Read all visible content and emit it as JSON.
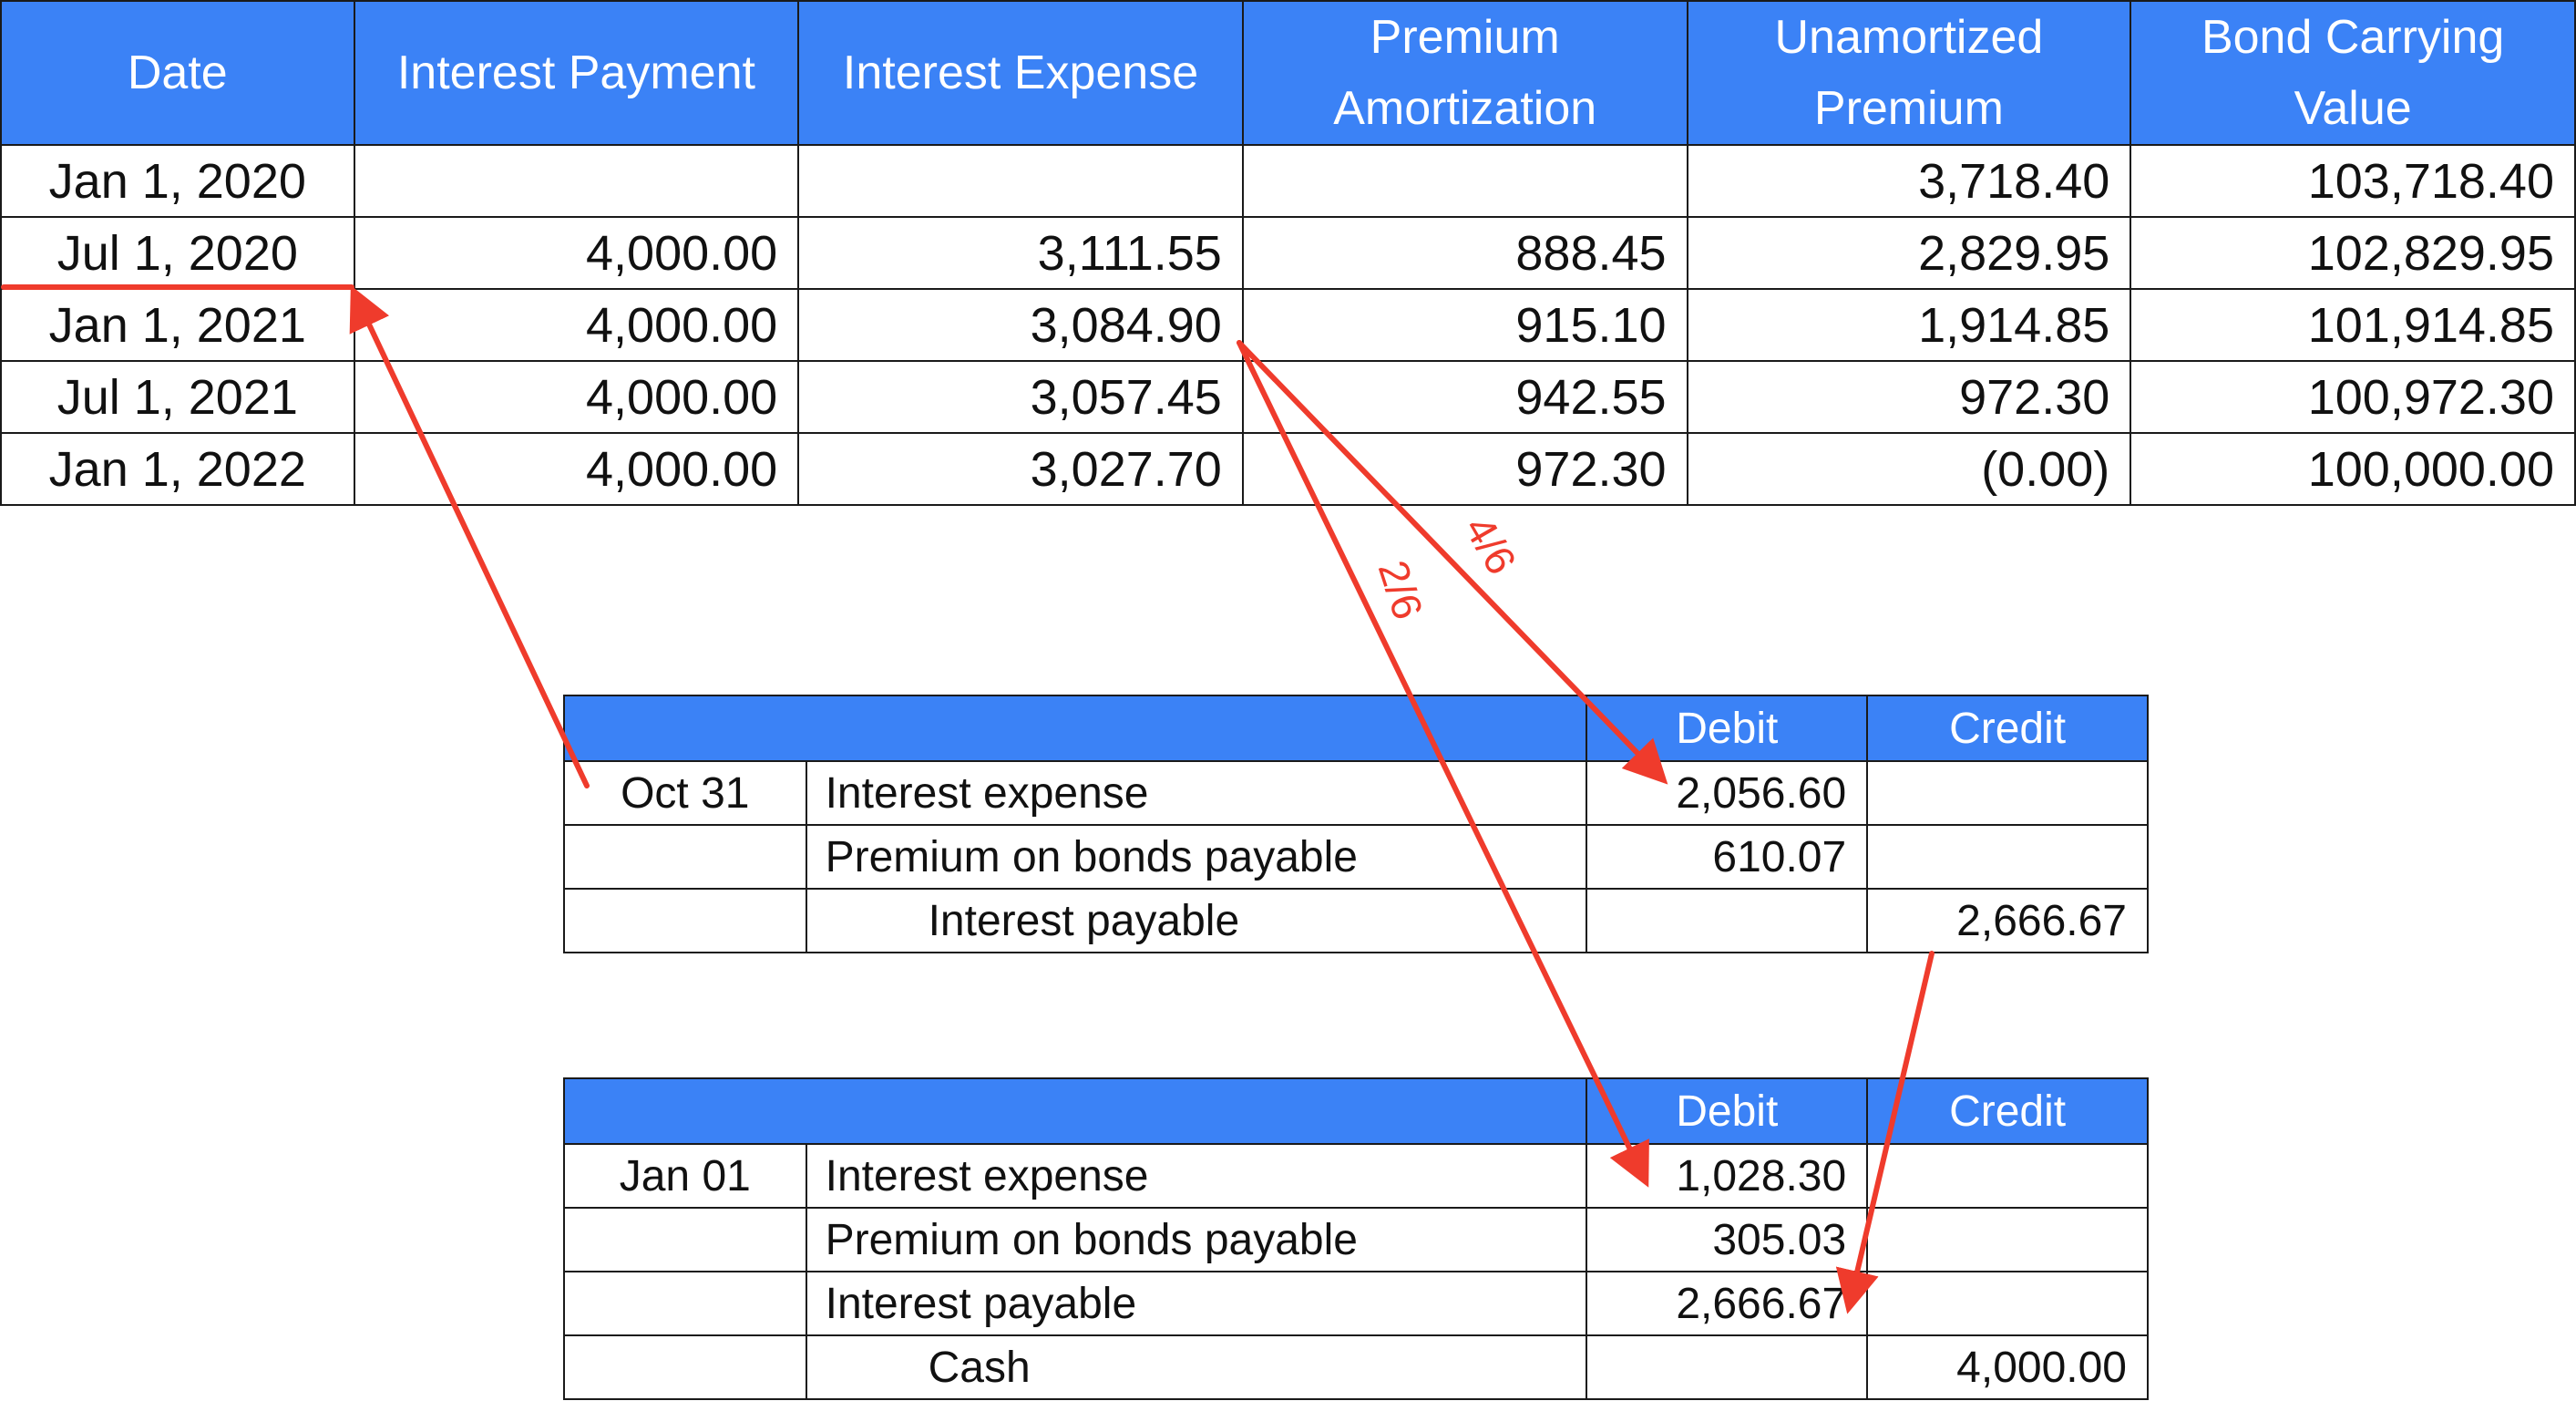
{
  "amortization": {
    "headers": {
      "date": "Date",
      "interest_payment": "Interest Payment",
      "interest_expense": "Interest Expense",
      "premium_amortization_1": "Premium",
      "premium_amortization_2": "Amortization",
      "unamortized_premium_1": "Unamortized",
      "unamortized_premium_2": "Premium",
      "carrying_value_1": "Bond Carrying",
      "carrying_value_2": "Value"
    },
    "rows": [
      {
        "date": "Jan 1, 2020",
        "payment": "",
        "expense": "",
        "amortization": "",
        "unamortized": "3,718.40",
        "carrying": "103,718.40"
      },
      {
        "date": "Jul 1, 2020",
        "payment": "4,000.00",
        "expense": "3,111.55",
        "amortization": "888.45",
        "unamortized": "2,829.95",
        "carrying": "102,829.95"
      },
      {
        "date": "Jan 1, 2021",
        "payment": "4,000.00",
        "expense": "3,084.90",
        "amortization": "915.10",
        "unamortized": "1,914.85",
        "carrying": "101,914.85"
      },
      {
        "date": "Jul 1, 2021",
        "payment": "4,000.00",
        "expense": "3,057.45",
        "amortization": "942.55",
        "unamortized": "972.30",
        "carrying": "100,972.30"
      },
      {
        "date": "Jan 1, 2022",
        "payment": "4,000.00",
        "expense": "3,027.70",
        "amortization": "972.30",
        "unamortized": "(0.00)",
        "carrying": "100,000.00"
      }
    ]
  },
  "journal_oct31": {
    "debit_label": "Debit",
    "credit_label": "Credit",
    "rows": [
      {
        "date": "Oct 31",
        "account": "Interest expense",
        "debit": "2,056.60",
        "credit": ""
      },
      {
        "date": "",
        "account": "Premium on bonds payable",
        "debit": "610.07",
        "credit": ""
      },
      {
        "date": "",
        "account": "Interest payable",
        "debit": "",
        "credit": "2,666.67"
      }
    ]
  },
  "journal_jan01": {
    "debit_label": "Debit",
    "credit_label": "Credit",
    "rows": [
      {
        "date": "Jan 01",
        "account": "Interest expense",
        "debit": "1,028.30",
        "credit": ""
      },
      {
        "date": "",
        "account": "Premium on bonds payable",
        "debit": "305.03",
        "credit": ""
      },
      {
        "date": "",
        "account": "Interest payable",
        "debit": "2,666.67",
        "credit": ""
      },
      {
        "date": "",
        "account": "Cash",
        "debit": "",
        "credit": "4,000.00"
      }
    ]
  },
  "annotations": {
    "fraction_four_sixths": "4/6",
    "fraction_two_sixths": "2/6",
    "arrow_color": "#ef3b2c"
  },
  "colors": {
    "header_bg": "#3b82f6",
    "header_text": "#ffffff",
    "border": "#1a1a1a"
  }
}
